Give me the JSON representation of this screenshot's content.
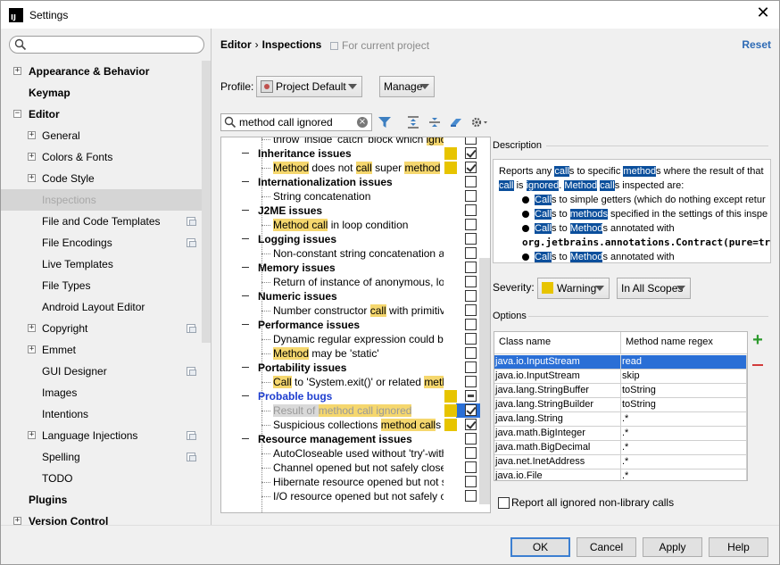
{
  "window": {
    "title": "Settings",
    "app_icon_text": "IJ"
  },
  "sidebar": {
    "search_placeholder": "",
    "items": [
      {
        "label": "Appearance & Behavior",
        "bold": true,
        "expander": "+"
      },
      {
        "label": "Keymap",
        "bold": true
      },
      {
        "label": "Editor",
        "bold": true,
        "expander": "-"
      },
      {
        "label": "General",
        "expander": "+"
      },
      {
        "label": "Colors & Fonts",
        "expander": "+"
      },
      {
        "label": "Code Style",
        "expander": "+"
      },
      {
        "label": "Inspections",
        "selected": true
      },
      {
        "label": "File and Code Templates",
        "project": true
      },
      {
        "label": "File Encodings",
        "project": true
      },
      {
        "label": "Live Templates"
      },
      {
        "label": "File Types"
      },
      {
        "label": "Android Layout Editor"
      },
      {
        "label": "Copyright",
        "expander": "+",
        "project": true
      },
      {
        "label": "Emmet",
        "expander": "+"
      },
      {
        "label": "GUI Designer",
        "project": true
      },
      {
        "label": "Images"
      },
      {
        "label": "Intentions"
      },
      {
        "label": "Language Injections",
        "expander": "+",
        "project": true
      },
      {
        "label": "Spelling",
        "project": true
      },
      {
        "label": "TODO"
      },
      {
        "label": "Plugins",
        "bold": true
      },
      {
        "label": "Version Control",
        "bold": true,
        "expander": "+"
      }
    ]
  },
  "header": {
    "crumb_editor": "Editor",
    "crumb_sep": "›",
    "crumb_inspections": "Inspections",
    "for_project": "For current project",
    "reset": "Reset"
  },
  "profile": {
    "label": "Profile:",
    "value": "Project Default",
    "manage": "Manage"
  },
  "filter": {
    "value": "method call ignored"
  },
  "inspections": [
    {
      "indent": 2,
      "parts": [
        [
          "throw' inside 'catch' block which ",
          false
        ],
        [
          "ignores",
          true
        ]
      ],
      "chk": "off"
    },
    {
      "indent": 1,
      "group": true,
      "parts": [
        [
          "Inheritance issues",
          false
        ]
      ],
      "sev": true,
      "chk": "on"
    },
    {
      "indent": 2,
      "parts": [
        [
          "Method",
          true
        ],
        [
          " does not ",
          false
        ],
        [
          "call",
          true
        ],
        [
          " super ",
          false
        ],
        [
          "method",
          true
        ]
      ],
      "sev": true,
      "chk": "on"
    },
    {
      "indent": 1,
      "group": true,
      "parts": [
        [
          "Internationalization issues",
          false
        ]
      ],
      "chk": "off"
    },
    {
      "indent": 2,
      "parts": [
        [
          "String concatenation",
          false
        ]
      ],
      "chk": "off"
    },
    {
      "indent": 1,
      "group": true,
      "parts": [
        [
          "J2ME issues",
          false
        ]
      ],
      "chk": "off"
    },
    {
      "indent": 2,
      "parts": [
        [
          "Method call",
          true
        ],
        [
          " in loop condition",
          false
        ]
      ],
      "chk": "off"
    },
    {
      "indent": 1,
      "group": true,
      "parts": [
        [
          "Logging issues",
          false
        ]
      ],
      "chk": "off"
    },
    {
      "indent": 2,
      "parts": [
        [
          "Non-constant string concatenation as a",
          false
        ]
      ],
      "chk": "off"
    },
    {
      "indent": 1,
      "group": true,
      "parts": [
        [
          "Memory issues",
          false
        ]
      ],
      "chk": "off"
    },
    {
      "indent": 2,
      "parts": [
        [
          "Return of instance of anonymous, local",
          false
        ]
      ],
      "chk": "off"
    },
    {
      "indent": 1,
      "group": true,
      "parts": [
        [
          "Numeric issues",
          false
        ]
      ],
      "chk": "off"
    },
    {
      "indent": 2,
      "parts": [
        [
          "Number constructor ",
          false
        ],
        [
          "call",
          true
        ],
        [
          " with primitive ar",
          false
        ]
      ],
      "chk": "off"
    },
    {
      "indent": 1,
      "group": true,
      "parts": [
        [
          "Performance issues",
          false
        ]
      ],
      "chk": "off"
    },
    {
      "indent": 2,
      "parts": [
        [
          "Dynamic regular expression could be re",
          false
        ]
      ],
      "chk": "off"
    },
    {
      "indent": 2,
      "parts": [
        [
          "Method",
          true
        ],
        [
          " may be 'static'",
          false
        ]
      ],
      "chk": "off"
    },
    {
      "indent": 1,
      "group": true,
      "parts": [
        [
          "Portability issues",
          false
        ]
      ],
      "chk": "off"
    },
    {
      "indent": 2,
      "parts": [
        [
          "Call",
          true
        ],
        [
          " to 'System.exit()' or related ",
          false
        ],
        [
          "method",
          true
        ]
      ],
      "chk": "off"
    },
    {
      "indent": 1,
      "group": true,
      "bugs": true,
      "parts": [
        [
          "Probable bugs",
          false
        ]
      ],
      "sev": true,
      "chk": "part"
    },
    {
      "indent": 2,
      "selected": true,
      "parts": [
        [
          "Result of ",
          false
        ],
        [
          "method call ignored",
          true
        ]
      ],
      "sev": true,
      "chk": "on"
    },
    {
      "indent": 2,
      "parts": [
        [
          "Suspicious collections ",
          false
        ],
        [
          "method call",
          true
        ],
        [
          "s",
          false
        ]
      ],
      "sev": true,
      "chk": "on"
    },
    {
      "indent": 1,
      "group": true,
      "parts": [
        [
          "Resource management issues",
          false
        ]
      ],
      "chk": "off"
    },
    {
      "indent": 2,
      "parts": [
        [
          "AutoCloseable used without 'try'-with-re",
          false
        ]
      ],
      "chk": "off"
    },
    {
      "indent": 2,
      "parts": [
        [
          "Channel opened but not safely closed",
          false
        ]
      ],
      "chk": "off"
    },
    {
      "indent": 2,
      "parts": [
        [
          "Hibernate resource opened but not safe",
          false
        ]
      ],
      "chk": "off"
    },
    {
      "indent": 2,
      "parts": [
        [
          "I/O resource opened but not safely clos",
          false
        ]
      ],
      "chk": "off"
    }
  ],
  "description": {
    "label": "Description",
    "intro": [
      [
        "Reports any ",
        false
      ],
      [
        "call",
        true
      ],
      [
        "s to specific ",
        false
      ],
      [
        "method",
        true
      ],
      [
        "s where the result of that ",
        false
      ],
      [
        "call",
        true
      ],
      [
        " is ",
        false
      ],
      [
        "ignored",
        true
      ],
      [
        ". ",
        false
      ],
      [
        "Method",
        true
      ],
      [
        " ",
        false
      ],
      [
        "call",
        true
      ],
      [
        "s inspected are:",
        false
      ]
    ],
    "bullets": [
      [
        [
          "Call",
          true
        ],
        [
          "s to simple getters (which do nothing except retur",
          false
        ]
      ],
      [
        [
          "Call",
          true
        ],
        [
          "s to ",
          false
        ],
        [
          "methods",
          true
        ],
        [
          " specified in the settings of this inspe",
          false
        ]
      ],
      [
        [
          "Call",
          true
        ],
        [
          "s to ",
          false
        ],
        [
          "Method",
          true
        ],
        [
          "s annotated with",
          false
        ]
      ],
      [
        [
          "Call",
          true
        ],
        [
          "s to ",
          false
        ],
        [
          "Method",
          true
        ],
        [
          "s annotated with",
          false
        ]
      ]
    ],
    "annotation": "org.jetbrains.annotations.Contract(pure=tru"
  },
  "severity": {
    "label": "Severity:",
    "value": "Warning",
    "scope": "In All Scopes"
  },
  "options": {
    "label": "Options",
    "col1": "Class name",
    "col2": "Method name regex",
    "rows": [
      [
        "java.io.InputStream",
        "read"
      ],
      [
        "java.io.InputStream",
        "skip"
      ],
      [
        "java.lang.StringBuffer",
        "toString"
      ],
      [
        "java.lang.StringBuilder",
        "toString"
      ],
      [
        "java.lang.String",
        ".*"
      ],
      [
        "java.math.BigInteger",
        ".*"
      ],
      [
        "java.math.BigDecimal",
        ".*"
      ],
      [
        "java.net.InetAddress",
        ".*"
      ],
      [
        "java.io.File",
        ".*"
      ]
    ],
    "report_label": "Report all ignored non-library calls"
  },
  "buttons": {
    "ok": "OK",
    "cancel": "Cancel",
    "apply": "Apply",
    "help": "Help"
  },
  "colors": {
    "highlight": "#f5d76e",
    "selection": "#2a6fd6",
    "warning": "#e7c400",
    "link": "#2e6bb5"
  }
}
